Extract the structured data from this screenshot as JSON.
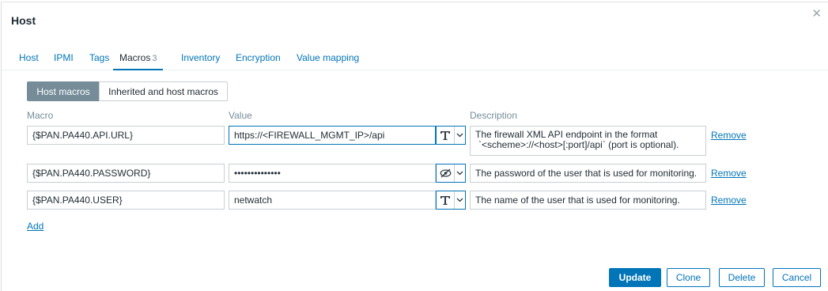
{
  "dialog": {
    "title": "Host",
    "close_icon": "close-icon"
  },
  "tabs": [
    {
      "label": "Host"
    },
    {
      "label": "IPMI"
    },
    {
      "label": "Tags"
    },
    {
      "label": "Macros",
      "count": "3",
      "active": true
    },
    {
      "label": "Inventory"
    },
    {
      "label": "Encryption"
    },
    {
      "label": "Value mapping"
    }
  ],
  "macro_view": {
    "host_macros": "Host macros",
    "inherited": "Inherited and host macros",
    "selected": "Host macros"
  },
  "columns": {
    "macro": "Macro",
    "value": "Value",
    "description": "Description"
  },
  "macros": [
    {
      "macro": "{$PAN.PA440.API.URL}",
      "value": "https://<FIREWALL_MGMT_IP>/api",
      "value_type_icon": "text-type-icon",
      "description_line1": "The firewall XML API endpoint in the format",
      "description_line2": "`<scheme>://<host>[:port]/api` (port is optional).",
      "remove": "Remove"
    },
    {
      "macro": "{$PAN.PA440.PASSWORD}",
      "value": "••••••••••••••",
      "value_type_icon": "secret-eye-slash-icon",
      "description_line1": "The password of the user that is used for monitoring.",
      "remove": "Remove"
    },
    {
      "macro": "{$PAN.PA440.USER}",
      "value": "netwatch",
      "value_type_icon": "text-type-icon",
      "description_line1": "The name of the user that is used for monitoring.",
      "remove": "Remove"
    }
  ],
  "add_link": "Add",
  "buttons": {
    "update": "Update",
    "clone": "Clone",
    "delete": "Delete",
    "cancel": "Cancel"
  },
  "colors": {
    "accent": "#0275b8",
    "muted": "#768d99"
  }
}
